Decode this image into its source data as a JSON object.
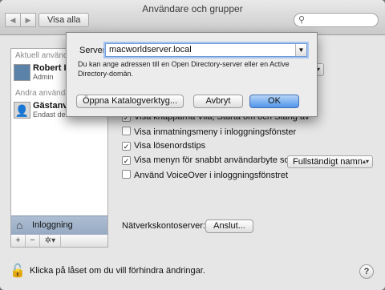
{
  "window": {
    "title": "Användare och grupper",
    "show_all": "Visa alla"
  },
  "toolbar": {
    "back_glyph": "◀",
    "forward_glyph": "▶",
    "search_icon": "magnifier-icon"
  },
  "sidebar": {
    "current_header": "Aktuell användar",
    "users": [
      {
        "name": "Robert Ili",
        "role": "Admin"
      }
    ],
    "other_header": "Andra användare",
    "guests": [
      {
        "name": "Gästanvä",
        "role": "Endast deli"
      }
    ],
    "login_item": "Inloggning",
    "buttons": {
      "add": "+",
      "remove": "−",
      "gear": "✲▾"
    }
  },
  "options": {
    "checkboxes": [
      {
        "label": "Visa knapparna Vila, Starta om och Stäng av",
        "checked": true
      },
      {
        "label": "Visa inmatningsmeny i inloggningsfönster",
        "checked": false
      },
      {
        "label": "Visa lösenordstips",
        "checked": true
      },
      {
        "label": "Visa menyn för snabbt användarbyte som",
        "checked": true
      },
      {
        "label": "Använd VoiceOver i inloggningsfönstret",
        "checked": false
      }
    ],
    "fast_switch_value": "Fullständigt namn",
    "network_label": "Nätverkskontoserver:",
    "connect_button": "Anslut..."
  },
  "footer": {
    "lock_text": "Klicka på låset om du vill förhindra ändringar.",
    "help": "?"
  },
  "sheet": {
    "server_label": "Server:",
    "server_value": "macworldserver.local",
    "hint": "Du kan ange adressen till en Open Directory-server eller en Active Directory-domän.",
    "open_button": "Öppna Katalogverktyg...",
    "cancel_button": "Avbryt",
    "ok_button": "OK"
  }
}
